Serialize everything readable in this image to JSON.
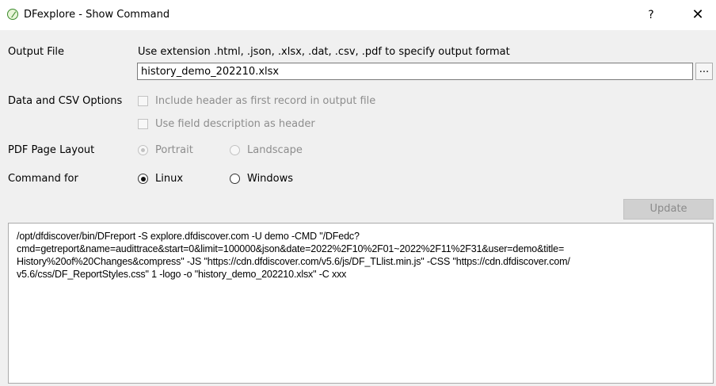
{
  "window": {
    "title": "DFexplore - Show Command",
    "help_label": "?",
    "close_label": "✕"
  },
  "output_file": {
    "label": "Output File",
    "hint": "Use extension .html, .json, .xlsx, .dat, .csv, .pdf to specify output format",
    "value": "history_demo_202210.xlsx",
    "browse_label": "..."
  },
  "data_csv": {
    "label": "Data and CSV Options",
    "include_header_label": "Include header as first record in output file",
    "include_header_checked": false,
    "field_desc_label": "Use field description as header",
    "field_desc_checked": false
  },
  "pdf_layout": {
    "label": "PDF Page Layout",
    "portrait_label": "Portrait",
    "landscape_label": "Landscape",
    "selected": "Portrait"
  },
  "command_for": {
    "label": "Command for",
    "linux_label": "Linux",
    "windows_label": "Windows",
    "selected": "Linux"
  },
  "update_label": "Update",
  "command_text": "/opt/dfdiscover/bin/DFreport -S explore.dfdiscover.com -U demo -CMD \"/DFedc?\ncmd=getreport&name=audittrace&start=0&limit=100000&json&date=2022%2F10%2F01~2022%2F11%2F31&user=demo&title=\nHistory%20of%20Changes&compress\" -JS \"https://cdn.dfdiscover.com/v5.6/js/DF_TLlist.min.js\" -CSS \"https://cdn.dfdiscover.com/\nv5.6/css/DF_ReportStyles.css\" 1 -logo -o \"history_demo_202210.xlsx\" -C xxx"
}
